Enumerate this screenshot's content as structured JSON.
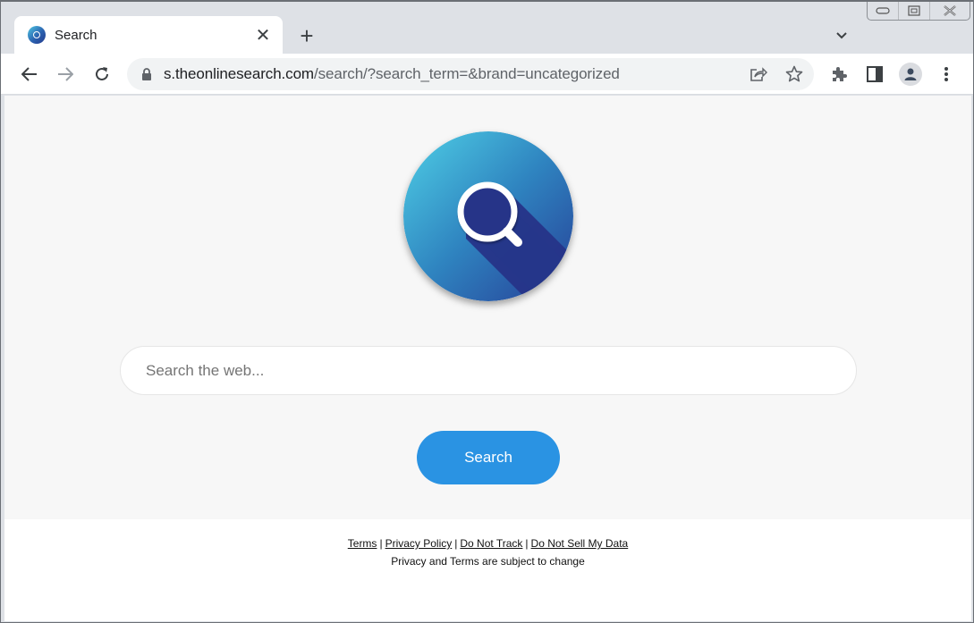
{
  "browser": {
    "tab": {
      "title": "Search",
      "close_glyph": "✕"
    },
    "new_tab_glyph": "+",
    "address_bar": {
      "url_host": "s.theonlinesearch.com",
      "url_path": "/search/?search_term=&brand=uncategorized"
    },
    "icons": {
      "back": "back-arrow-icon",
      "forward": "forward-arrow-icon",
      "reload": "reload-icon",
      "lock": "lock-icon",
      "share": "share-icon",
      "bookmark": "star-icon",
      "extensions": "puzzle-icon",
      "side_panel": "side-panel-icon",
      "profile": "profile-icon",
      "menu": "kebab-menu-icon",
      "tab_search": "chevron-down-icon"
    }
  },
  "page": {
    "search": {
      "placeholder": "Search the web...",
      "value": "",
      "button_label": "Search",
      "button_color": "#2a93e3"
    },
    "footer": {
      "links": [
        "Terms",
        "Privacy Policy",
        "Do Not Track",
        "Do Not Sell My Data"
      ],
      "separator": "|",
      "note": "Privacy and Terms are subject to change"
    }
  }
}
